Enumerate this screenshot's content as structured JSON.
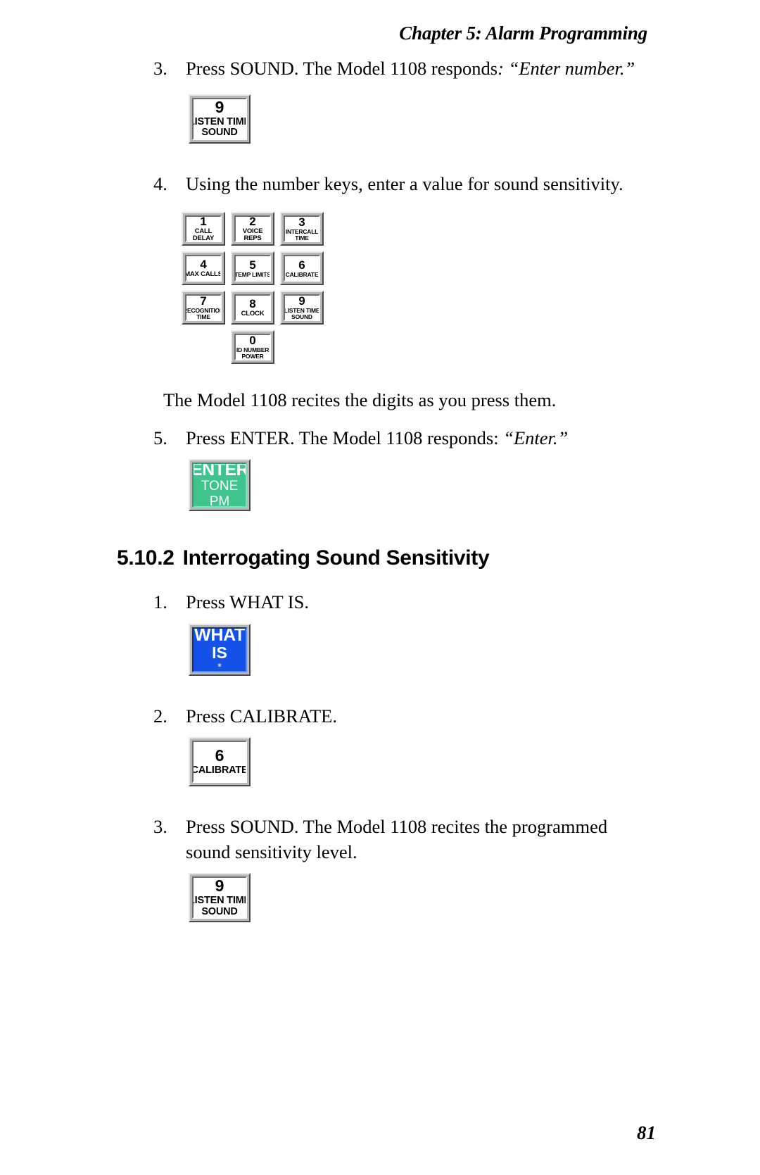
{
  "header": {
    "running_head": "Chapter 5: Alarm Programming"
  },
  "footer": {
    "page_number": "81"
  },
  "steps": {
    "s3_num": "3.",
    "s3_text_a": "Press SOUND. The Model 1108 responds",
    "s3_text_b": ": “Enter number.”",
    "s4_num": "4.",
    "s4_text": "Using the number keys, enter a value for sound sensitivity.",
    "recite_para": "The Model 1108 recites the digits as you press them.",
    "s5_num": "5.",
    "s5_text_a": "Press ENTER.  The Model 1108 responds: ",
    "s5_text_b": "“Enter.”",
    "i1_num": "1.",
    "i1_text": "Press WHAT IS.",
    "i2_num": "2.",
    "i2_text": "Press CALIBRATE.",
    "i3_num": "3.",
    "i3_text": "Press SOUND. The Model 1108 recites the programmed sound sensitivity level."
  },
  "section": {
    "number": "5.10.2",
    "title": "Interrogating Sound Sensitivity"
  },
  "keys": {
    "sound_top": {
      "digit": "9",
      "line2": "LISTEN TIME",
      "line3": "SOUND"
    },
    "sound_bottom": {
      "digit": "9",
      "line2": "LISTEN TIME",
      "line3": "SOUND"
    },
    "enter": {
      "line1": "ENTER",
      "line2": "TONE",
      "line3": "PM",
      "color": "#3fc58c"
    },
    "whatis": {
      "line1": "WHAT",
      "line2": "IS",
      "line3": "*",
      "color": "#1351e8"
    },
    "calibrate": {
      "digit": "6",
      "line2": "CALIBRATE"
    }
  },
  "keypad": {
    "rows": [
      [
        {
          "digit": "1",
          "line2": "CALL",
          "line3": "DELAY"
        },
        {
          "digit": "2",
          "line2": "VOICE",
          "line3": "REPS"
        },
        {
          "digit": "3",
          "line2": "INTERCALL",
          "line3": "TIME"
        }
      ],
      [
        {
          "digit": "4",
          "line2": "MAX CALLS",
          "line3": ""
        },
        {
          "digit": "5",
          "line2": "TEMP LIMITS",
          "line3": ""
        },
        {
          "digit": "6",
          "line2": "CALIBRATE",
          "line3": ""
        }
      ],
      [
        {
          "digit": "7",
          "line2": "RECOGNITION",
          "line3": "TIME"
        },
        {
          "digit": "8",
          "line2": "CLOCK",
          "line3": ""
        },
        {
          "digit": "9",
          "line2": "LISTEN TIME",
          "line3": "SOUND"
        }
      ]
    ],
    "zero": {
      "digit": "0",
      "line2": "ID NUMBER",
      "line3": "POWER"
    }
  }
}
